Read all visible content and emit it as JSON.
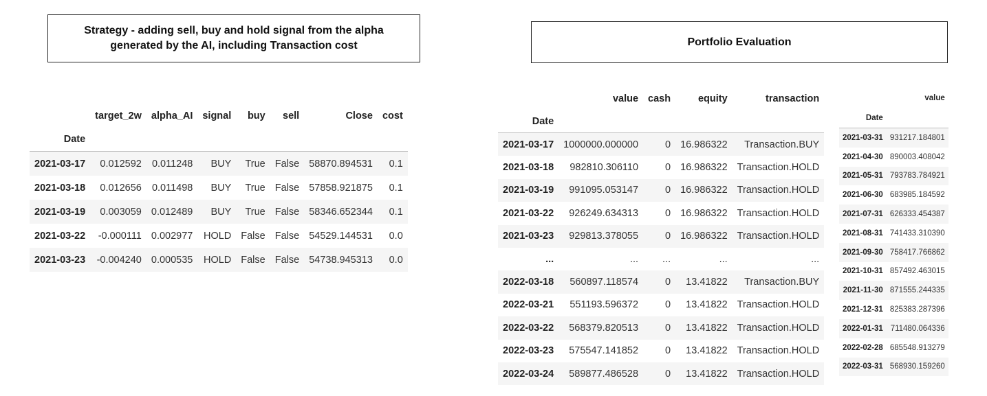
{
  "left_title": "Strategy - adding sell, buy and hold signal from the alpha generated by the AI, including Transaction cost",
  "right_title": "Portfolio Evaluation",
  "strategy": {
    "columns": [
      "target_2w",
      "alpha_AI",
      "signal",
      "buy",
      "sell",
      "Close",
      "cost"
    ],
    "index_name": "Date",
    "rows": [
      {
        "date": "2021-03-17",
        "cells": [
          "0.012592",
          "0.011248",
          "BUY",
          "True",
          "False",
          "58870.894531",
          "0.1"
        ]
      },
      {
        "date": "2021-03-18",
        "cells": [
          "0.012656",
          "0.011498",
          "BUY",
          "True",
          "False",
          "57858.921875",
          "0.1"
        ]
      },
      {
        "date": "2021-03-19",
        "cells": [
          "0.003059",
          "0.012489",
          "BUY",
          "True",
          "False",
          "58346.652344",
          "0.1"
        ]
      },
      {
        "date": "2021-03-22",
        "cells": [
          "-0.000111",
          "0.002977",
          "HOLD",
          "False",
          "False",
          "54529.144531",
          "0.0"
        ]
      },
      {
        "date": "2021-03-23",
        "cells": [
          "-0.004240",
          "0.000535",
          "HOLD",
          "False",
          "False",
          "54738.945313",
          "0.0"
        ]
      }
    ]
  },
  "portfolio": {
    "columns": [
      "value",
      "cash",
      "equity",
      "transaction"
    ],
    "index_name": "Date",
    "rows": [
      {
        "date": "2021-03-17",
        "cells": [
          "1000000.000000",
          "0",
          "16.986322",
          "Transaction.BUY"
        ]
      },
      {
        "date": "2021-03-18",
        "cells": [
          "982810.306110",
          "0",
          "16.986322",
          "Transaction.HOLD"
        ]
      },
      {
        "date": "2021-03-19",
        "cells": [
          "991095.053147",
          "0",
          "16.986322",
          "Transaction.HOLD"
        ]
      },
      {
        "date": "2021-03-22",
        "cells": [
          "926249.634313",
          "0",
          "16.986322",
          "Transaction.HOLD"
        ]
      },
      {
        "date": "2021-03-23",
        "cells": [
          "929813.378055",
          "0",
          "16.986322",
          "Transaction.HOLD"
        ]
      },
      {
        "date": "...",
        "cells": [
          "...",
          "...",
          "...",
          "..."
        ]
      },
      {
        "date": "2022-03-18",
        "cells": [
          "560897.118574",
          "0",
          "13.41822",
          "Transaction.BUY"
        ]
      },
      {
        "date": "2022-03-21",
        "cells": [
          "551193.596372",
          "0",
          "13.41822",
          "Transaction.HOLD"
        ]
      },
      {
        "date": "2022-03-22",
        "cells": [
          "568379.820513",
          "0",
          "13.41822",
          "Transaction.HOLD"
        ]
      },
      {
        "date": "2022-03-23",
        "cells": [
          "575547.141852",
          "0",
          "13.41822",
          "Transaction.HOLD"
        ]
      },
      {
        "date": "2022-03-24",
        "cells": [
          "589877.486528",
          "0",
          "13.41822",
          "Transaction.HOLD"
        ]
      }
    ]
  },
  "monthly": {
    "columns": [
      "value"
    ],
    "index_name": "Date",
    "rows": [
      {
        "date": "2021-03-31",
        "cells": [
          "931217.184801"
        ]
      },
      {
        "date": "2021-04-30",
        "cells": [
          "890003.408042"
        ]
      },
      {
        "date": "2021-05-31",
        "cells": [
          "793783.784921"
        ]
      },
      {
        "date": "2021-06-30",
        "cells": [
          "683985.184592"
        ]
      },
      {
        "date": "2021-07-31",
        "cells": [
          "626333.454387"
        ]
      },
      {
        "date": "2021-08-31",
        "cells": [
          "741433.310390"
        ]
      },
      {
        "date": "2021-09-30",
        "cells": [
          "758417.766862"
        ]
      },
      {
        "date": "2021-10-31",
        "cells": [
          "857492.463015"
        ]
      },
      {
        "date": "2021-11-30",
        "cells": [
          "871555.244335"
        ]
      },
      {
        "date": "2021-12-31",
        "cells": [
          "825383.287396"
        ]
      },
      {
        "date": "2022-01-31",
        "cells": [
          "711480.064336"
        ]
      },
      {
        "date": "2022-02-28",
        "cells": [
          "685548.913279"
        ]
      },
      {
        "date": "2022-03-31",
        "cells": [
          "568930.159260"
        ]
      }
    ]
  }
}
